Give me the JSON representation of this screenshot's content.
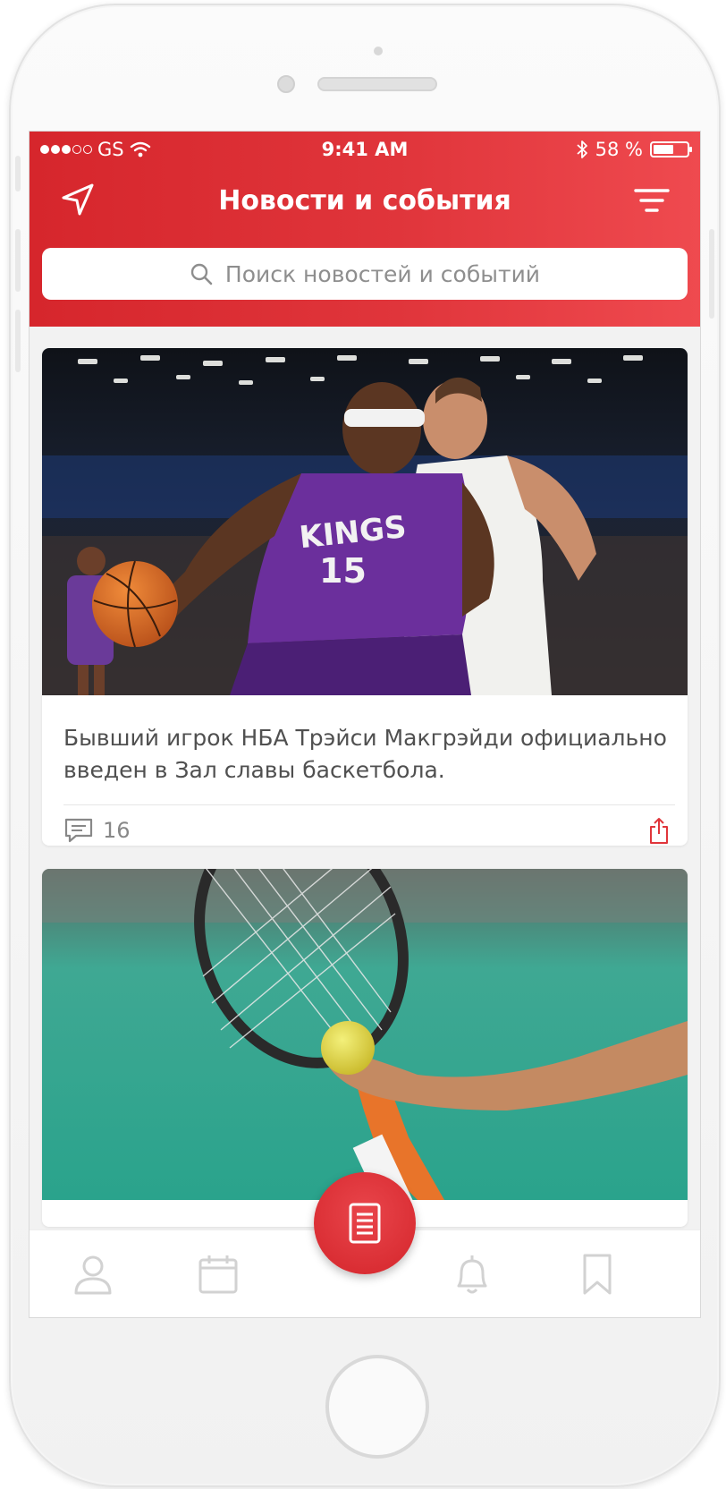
{
  "status_bar": {
    "carrier": "GS",
    "time": "9:41 AM",
    "battery": "58 %"
  },
  "header": {
    "title": "Новости и события",
    "search_placeholder": "Поиск новостей и событий"
  },
  "feed": [
    {
      "title": "Бывший игрок НБА Трэйси Макгрэйди официально введен в Зал славы баскетбола.",
      "comments": "16",
      "image": "basketball-photo",
      "jersey_team": "KINGS",
      "jersey_number": "15"
    },
    {
      "image": "tennis-photo"
    }
  ],
  "tabbar": {
    "items": [
      "profile-icon",
      "calendar-icon",
      "news-icon",
      "bell-icon",
      "bookmark-icon"
    ],
    "active": "news-icon"
  },
  "colors": {
    "accent": "#e0353b",
    "accent_dark": "#d4252b"
  }
}
